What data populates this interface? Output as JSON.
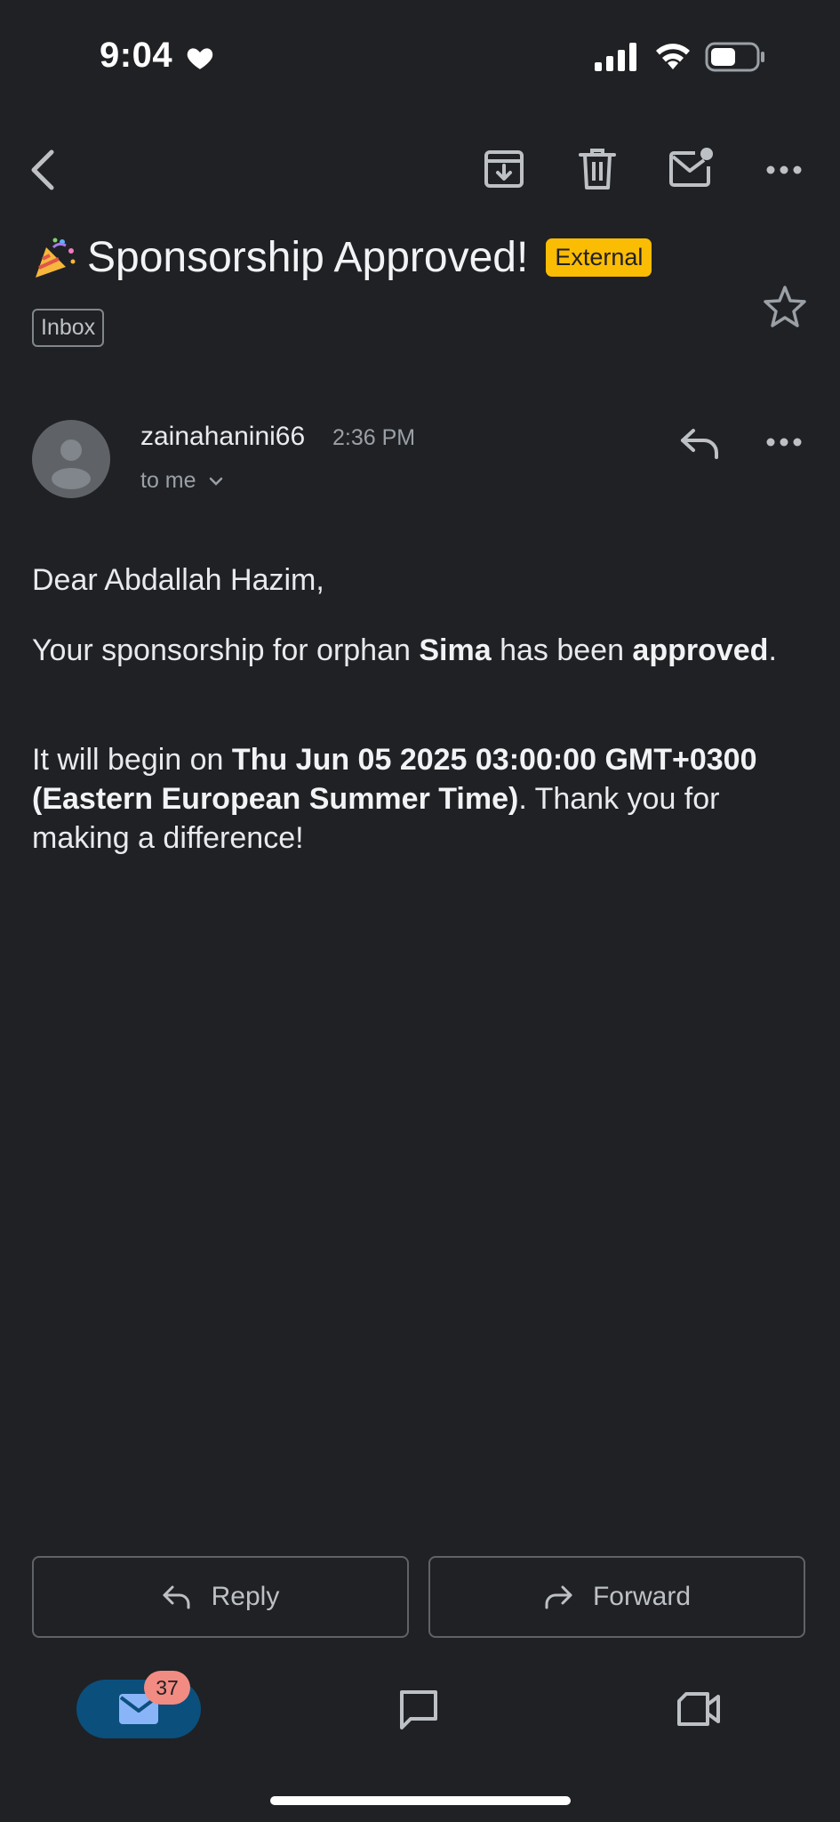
{
  "status_bar": {
    "time": "9:04",
    "icons": [
      "heart-icon",
      "cellular-signal-icon",
      "wifi-icon",
      "battery-icon"
    ]
  },
  "toolbar": {
    "icons": [
      "back-icon",
      "archive-icon",
      "trash-icon",
      "mark-unread-icon",
      "more-icon"
    ]
  },
  "email": {
    "subject": "Sponsorship Approved!",
    "subject_emoji_icon": "party-popper-icon",
    "external_badge": "External",
    "label": "Inbox",
    "sender": "zainahanini66",
    "time": "2:36 PM",
    "recipient": "to me",
    "body": {
      "greeting": "Dear Abdallah Hazim,",
      "p2_a": "Your sponsorship for orphan ",
      "p2_b": "Sima",
      "p2_c": " has been ",
      "p2_d": "approved",
      "p2_e": ".",
      "p3_a": "It will begin on ",
      "p3_b": "Thu Jun 05 2025 03:00:00 GMT+0300 (Eastern European Summer Time)",
      "p3_c": ". Thank you for making a difference!"
    }
  },
  "actions": {
    "reply_label": "Reply",
    "forward_label": "Forward"
  },
  "bottom_nav": {
    "mail_badge": "37",
    "items": [
      "mail-icon",
      "chat-icon",
      "meet-video-icon"
    ]
  },
  "colors": {
    "background": "#202124",
    "external_badge": "#fbbc04",
    "nav_active": "#0b4f7c",
    "badge": "#f28b82"
  }
}
